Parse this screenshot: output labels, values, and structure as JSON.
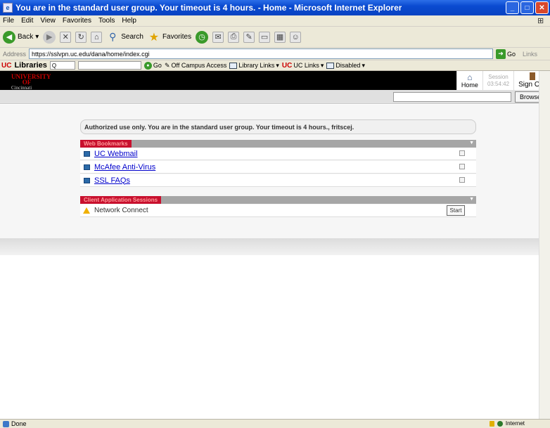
{
  "window": {
    "title": "You are in the standard user group. Your timeout is 4 hours. - Home - Microsoft Internet Explorer"
  },
  "menu": [
    "File",
    "Edit",
    "View",
    "Favorites",
    "Tools",
    "Help"
  ],
  "toolbar": {
    "back_label": "Back",
    "search_label": "Search",
    "favorites_label": "Favorites"
  },
  "address": {
    "label": "Address",
    "url": "https://sslvpn.uc.edu/dana/home/index.cgi",
    "go_label": "Go",
    "links_label": "Links"
  },
  "links_bar": {
    "libraries_label": "Libraries",
    "go_label": "Go",
    "off_campus_label": "Off Campus Access",
    "library_links_label": "Library Links",
    "uc_links_label": "UC Links",
    "disabled_label": "Disabled"
  },
  "header": {
    "brand_line1": "UNIVERSITY OF",
    "brand_line2": "Cincinnati",
    "home_label": "Home",
    "session_label": "Session",
    "session_time": "03:54:42",
    "signout_label": "Sign Out"
  },
  "browse": {
    "button_label": "Browse"
  },
  "notice": {
    "text": "Authorized use only. You are in the standard user group. Your timeout is 4 hours., fritscej."
  },
  "web_bookmarks": {
    "title": "Web Bookmarks",
    "items": [
      {
        "label": "UC Webmail"
      },
      {
        "label": "McAfee Anti-Virus"
      },
      {
        "label": "SSL FAQs"
      }
    ]
  },
  "client_apps": {
    "title": "Client Application Sessions",
    "items": [
      {
        "label": "Network Connect",
        "action": "Start"
      }
    ]
  },
  "status": {
    "left": "Done",
    "zone": "Internet"
  }
}
